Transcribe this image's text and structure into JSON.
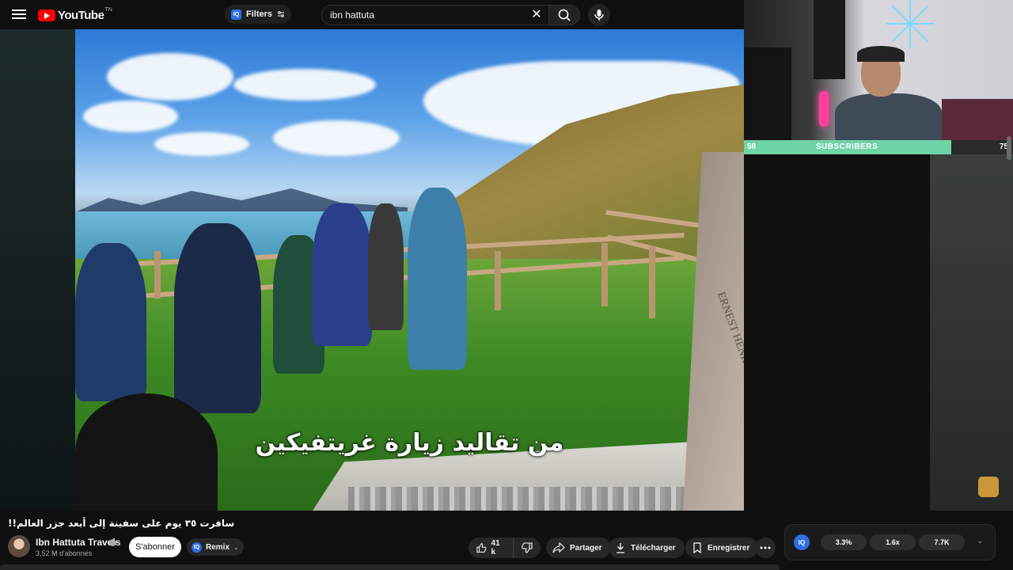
{
  "header": {
    "logo_text": "YouTube",
    "logo_suffix": "TN",
    "filters_badge": "IQ",
    "filters_label": "Filters",
    "search_value": "ibn hattuta"
  },
  "video": {
    "subtitle": "من تقاليد زيارة غريتفيكين",
    "stone_inscription": "ERNEST HENRY SHACKLETON EXPLORER"
  },
  "overlay": {
    "subscribers_label": "SUBSCRIBERS",
    "subscribers_current": "58",
    "subscribers_goal": "75",
    "subscribers_progress": 0.77
  },
  "details": {
    "title": "سافرت ٣٥ يوم على سفينة إلى أبعد جزر العالم!!",
    "channel_name": "Ibn Hattuta Travels",
    "subscriber_count": "3,52 M d'abonnés",
    "subscribe_label": "S'abonner",
    "remix_badge": "IQ",
    "remix_label": "Remix"
  },
  "actions": {
    "like_count": "41 k",
    "share_label": "Partager",
    "download_label": "Télécharger",
    "save_label": "Enregistrer"
  },
  "stats": {
    "badge": "IQ",
    "values": [
      "3.3%",
      "1.6x",
      "7.7K"
    ]
  },
  "colors": {
    "accent_red": "#ff0000",
    "subscribe_bar": "#6fd3a8",
    "iq_blue": "#2f6fe4"
  }
}
